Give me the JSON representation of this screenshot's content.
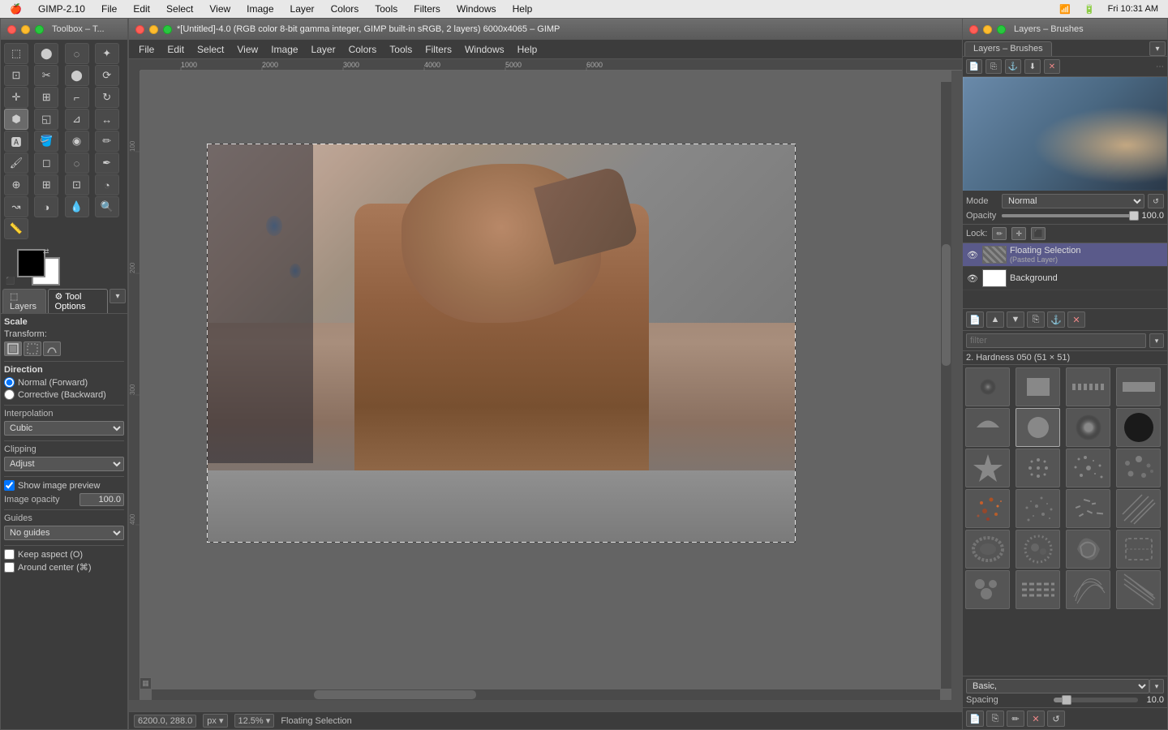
{
  "menubar": {
    "apple": "🍎",
    "app_name": "GIMP-2.10",
    "menus": [
      "File",
      "Edit",
      "Select",
      "View",
      "Image",
      "Layer",
      "Colors",
      "Tools",
      "Filters",
      "Windows",
      "Help"
    ],
    "right": [
      "Fri 10:31 AM",
      "100%"
    ],
    "select_label": "Select",
    "colors_label": "Colors"
  },
  "toolbox": {
    "title": "Toolbox – T...",
    "color_fg": "#000000",
    "color_bg": "#ffffff",
    "tabs": [
      "Layers",
      "Tool Options"
    ],
    "tool_options": {
      "scale_label": "Scale",
      "transform_label": "Transform:",
      "direction_label": "Direction",
      "direction_normal": "Normal (Forward)",
      "direction_corrective": "Corrective (Backward)",
      "interpolation_label": "Interpolation",
      "interpolation_value": "Cubic",
      "clipping_label": "Clipping",
      "clipping_value": "Adjust",
      "show_preview_label": "Show image preview",
      "image_opacity_label": "Image opacity",
      "image_opacity_value": "100.0",
      "guides_label": "Guides",
      "guides_value": "No guides",
      "keep_aspect_label": "Keep aspect (O)",
      "around_center_label": "Around center (⌘)"
    }
  },
  "main_window": {
    "title": "*[Untitled]-4.0 (RGB color 8-bit gamma integer, GIMP built-in sRGB, 2 layers) 6000x4065 – GIMP",
    "status": {
      "coords": "6200.0, 288.0",
      "unit": "px",
      "zoom": "12.5%",
      "selection": "Floating Selection"
    },
    "canvas_bg": "#646464"
  },
  "layers_brushes": {
    "title": "Layers – Brushes",
    "mode_label": "Mode",
    "mode_value": "Normal",
    "opacity_label": "Opacity",
    "opacity_value": "100.0",
    "lock_label": "Lock:",
    "layers": [
      {
        "name": "Floating Selection",
        "subtitle": "(Pasted Layer)",
        "visible": true,
        "thumb_style": "striped"
      },
      {
        "name": "Background",
        "subtitle": "",
        "visible": true,
        "thumb_style": "white"
      }
    ],
    "layer_action_icons": [
      "↓",
      "↑",
      "⬛",
      "📋",
      "✕"
    ],
    "brushes": {
      "filter_placeholder": "filter",
      "selected_brush": "2. Hardness 050 (51 × 51)",
      "items": [
        {
          "shape": "soft_round_sm",
          "label": ""
        },
        {
          "shape": "hard_rect",
          "label": ""
        },
        {
          "shape": "dash_line",
          "label": ""
        },
        {
          "shape": "hard_line_thick",
          "label": ""
        },
        {
          "shape": "half_circle",
          "label": ""
        },
        {
          "shape": "hard_round_mid",
          "label": ""
        },
        {
          "shape": "soft_round_lg",
          "label": ""
        },
        {
          "shape": "hard_round_lg",
          "label": ""
        },
        {
          "shape": "star",
          "label": ""
        },
        {
          "shape": "dotted_cross",
          "label": ""
        },
        {
          "shape": "dotted_scatter",
          "label": ""
        },
        {
          "shape": "scatter2",
          "label": ""
        },
        {
          "shape": "spray1",
          "label": ""
        },
        {
          "shape": "spray2",
          "label": ""
        },
        {
          "shape": "spray3",
          "label": ""
        },
        {
          "shape": "hatch",
          "label": ""
        },
        {
          "shape": "grunge1",
          "label": ""
        },
        {
          "shape": "grunge2",
          "label": ""
        },
        {
          "shape": "grunge3",
          "label": ""
        },
        {
          "shape": "grunge4",
          "label": ""
        },
        {
          "shape": "grunge5",
          "label": ""
        },
        {
          "shape": "dashes",
          "label": ""
        },
        {
          "shape": "sketch1",
          "label": ""
        },
        {
          "shape": "sketch2",
          "label": ""
        }
      ],
      "basic_label": "Basic,",
      "spacing_label": "Spacing",
      "spacing_value": "10.0"
    }
  },
  "tools": {
    "icons": [
      "✚",
      "⬚",
      "○",
      "⬤",
      "∿",
      "⊹",
      "✂",
      "❐",
      "↖",
      "↔",
      "⊞",
      "⌐",
      "↗",
      "⟲",
      "◱",
      "⊿",
      "🖊",
      "✏",
      "◻",
      "⬢",
      "⟩",
      "♦",
      "⊃",
      "⟳",
      "🪣",
      "◉",
      "🔲",
      "⊡",
      "◾",
      "⁘",
      "⟳",
      "↺",
      "⬡",
      "↘",
      "⊡",
      "🖋",
      "🅰",
      "✎",
      "↕",
      "🔑",
      "🔵",
      "◌",
      "◉"
    ]
  }
}
